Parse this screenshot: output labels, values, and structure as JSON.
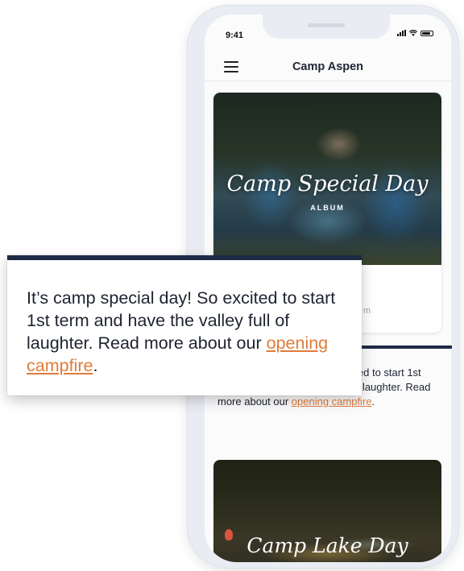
{
  "status_bar": {
    "time": "9:41"
  },
  "app": {
    "title": "Camp Aspen"
  },
  "feed": {
    "album_card": {
      "title": "Camp Special Day",
      "subtitle": "ALBUM",
      "meta_fragment": "m"
    },
    "post": {
      "text_before_link": "It’s camp special day! So excited to start 1st term and have the valley full of laughter. Read more about our ",
      "link_text": "opening campfire",
      "text_after_link": "."
    },
    "lake_card": {
      "title": "Camp Lake Day"
    }
  },
  "zoom_popup": {
    "text_before_link": "It’s camp special day! So excited to start 1st term and have the valley full of laughter. Read more about our ",
    "link_text": "opening campfire",
    "text_after_link": "."
  },
  "colors": {
    "link": "#e07b39",
    "accent_bar": "#1d2b45"
  }
}
